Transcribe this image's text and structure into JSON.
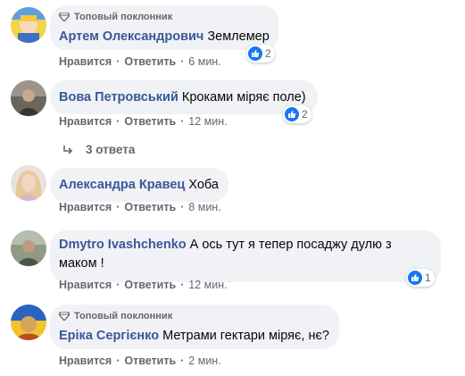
{
  "comments": [
    {
      "badge": "Топовый поклонник",
      "author": "Артем Олександрович",
      "text": "Землемер",
      "like": "Нравится",
      "reply": "Ответить",
      "time": "6 мин.",
      "reactions": "2"
    },
    {
      "author": "Вова Петровський",
      "text": "Кроками міряє поле)",
      "like": "Нравится",
      "reply": "Ответить",
      "time": "12 мин.",
      "reactions": "2",
      "replies_label": "3 ответа"
    },
    {
      "author": "Александра Кравец",
      "text": "Хоба",
      "like": "Нравится",
      "reply": "Ответить",
      "time": "8 мин."
    },
    {
      "author": "Dmytro Ivashchenko",
      "text_line1": "А ось тут я тепер посаджу дулю з",
      "text_line2": "маком !",
      "like": "Нравится",
      "reply": "Ответить",
      "time": "12 мин.",
      "reactions": "1"
    },
    {
      "badge": "Топовый поклонник",
      "author": "Еріка Сергієнко",
      "text": "Метрами гектари міряє, нє?",
      "like": "Нравится",
      "reply": "Ответить",
      "time": "2 мин."
    }
  ],
  "colors": {
    "author": "#385898",
    "bubble": "#f0f2f5",
    "like_blue": "#1877f2",
    "meta": "#65676b"
  },
  "icons": {
    "badge": "diamond-icon",
    "reaction": "thumbs-up-icon",
    "replies": "reply-arrow-icon"
  }
}
